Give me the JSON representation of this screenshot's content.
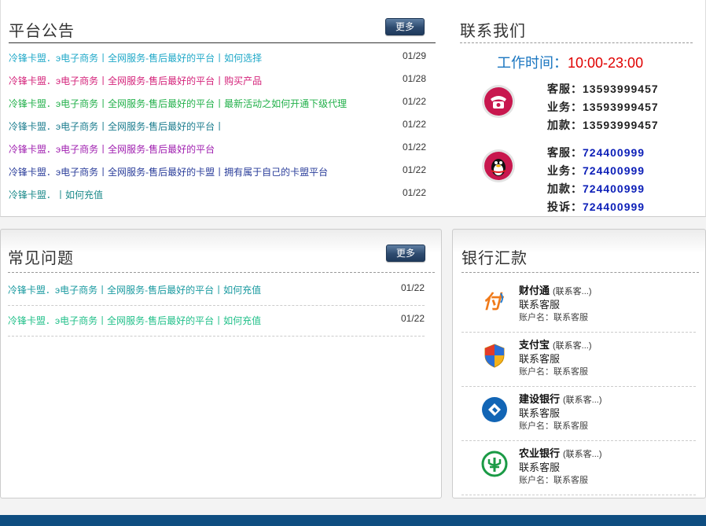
{
  "notice": {
    "title": "平台公告",
    "more": "更多",
    "items": [
      {
        "text": "冷锋卡盟．э电子商务丨全网服务-售后最好的平台丨如何选择",
        "date": "01/29",
        "color": "#1fa8c8"
      },
      {
        "text": "冷锋卡盟．э电子商务丨全网服务-售后最好的平台丨购买产品",
        "date": "01/28",
        "color": "#d4237a"
      },
      {
        "text": "冷锋卡盟．э电子商务丨全网服务-售后最好的平台丨最新活动之如何开通下级代理",
        "date": "01/22",
        "color": "#22b04a"
      },
      {
        "text": "冷锋卡盟．э电子商务丨全网服务-售后最好的平台丨",
        "date": "01/22",
        "color": "#1b7c8e"
      },
      {
        "text": "冷锋卡盟．э电子商务丨全网服务-售后最好的平台",
        "date": "01/22",
        "color": "#a020b0"
      },
      {
        "text": "冷锋卡盟．э电子商务丨全网服务-售后最好的卡盟丨拥有属于自己的卡盟平台",
        "date": "01/22",
        "color": "#2a3d9a"
      },
      {
        "text": "冷锋卡盟．丨如何充值",
        "date": "01/22",
        "color": "#1b8a8a"
      }
    ]
  },
  "contact": {
    "title": "联系我们",
    "hours_label": "工作时间：",
    "hours_value": "10:00-23:00",
    "hours_label_color": "#1a76c0",
    "hours_value_color": "#e00000",
    "phone_icon": "telephone-icon",
    "qq_icon": "qq-penguin-icon",
    "phones": [
      {
        "label": "客服：",
        "value": "13593999457"
      },
      {
        "label": "业务：",
        "value": "13593999457"
      },
      {
        "label": "加款：",
        "value": "13593999457"
      }
    ],
    "qq": [
      {
        "label": "客服：",
        "value": "724400999"
      },
      {
        "label": "业务：",
        "value": "724400999"
      },
      {
        "label": "加款：",
        "value": "724400999"
      },
      {
        "label": "投诉：",
        "value": "724400999"
      }
    ],
    "qq_value_color": "#0c1fb8"
  },
  "faq": {
    "title": "常见问题",
    "more": "更多",
    "items": [
      {
        "text": "冷锋卡盟．э电子商务丨全网服务-售后最好的平台丨如何充值",
        "date": "01/22",
        "color": "#1a9aa0"
      },
      {
        "text": "冷锋卡盟．э电子商务丨全网服务-售后最好的平台丨如何充值",
        "date": "01/22",
        "color": "#22c08a"
      }
    ]
  },
  "bank": {
    "title": "银行汇款",
    "items": [
      {
        "name": "财付通",
        "sub": "(联系客...)",
        "account": "联系客服",
        "holder": "账户名：联系客服",
        "icon": "tenpay-icon"
      },
      {
        "name": "支付宝",
        "sub": "(联系客...)",
        "account": "联系客服",
        "holder": "账户名：联系客服",
        "icon": "alipay-shield-icon"
      },
      {
        "name": "建设银行",
        "sub": "(联系客...)",
        "account": "联系客服",
        "holder": "账户名：联系客服",
        "icon": "ccb-bank-icon"
      },
      {
        "name": "农业银行",
        "sub": "(联系客...)",
        "account": "联系客服",
        "holder": "账户名：联系客服",
        "icon": "abc-bank-icon"
      }
    ]
  }
}
